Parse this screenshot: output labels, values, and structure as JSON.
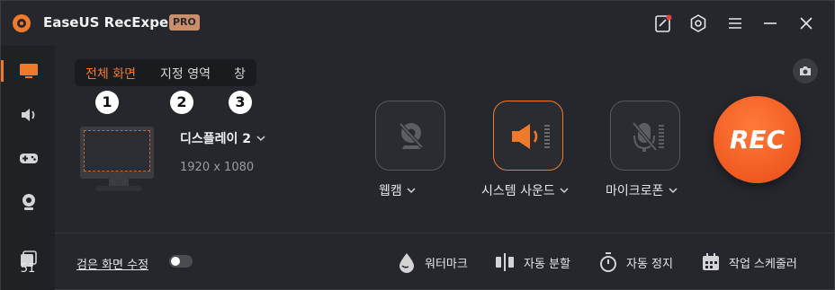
{
  "titlebar": {
    "title": "EaseUS RecExperts",
    "badge": "PRO",
    "accent": "#f07a2c"
  },
  "sidebar": {
    "items": [
      {
        "name": "screen-record",
        "icon": "monitor-icon",
        "active": true
      },
      {
        "name": "audio-record",
        "icon": "speaker-icon"
      },
      {
        "name": "game-record",
        "icon": "gamepad-icon"
      },
      {
        "name": "webcam-record",
        "icon": "webcam-icon"
      }
    ],
    "files_count": "51"
  },
  "tabs": [
    "전체 화면",
    "지정 영역",
    "창"
  ],
  "tab_numbers": [
    "1",
    "2",
    "3"
  ],
  "display": {
    "name": "디스플레이 2",
    "resolution": "1920 x 1080"
  },
  "sources": {
    "webcam_label": "웹캠",
    "system_sound_label": "시스템 사운드",
    "microphone_label": "마이크로폰"
  },
  "rec_label": "REC",
  "bottom": {
    "black_screen_fix": "검은 화면 수정",
    "tools": [
      "워터마크",
      "자동 분할",
      "자동 정지",
      "작업 스케줄러"
    ]
  }
}
